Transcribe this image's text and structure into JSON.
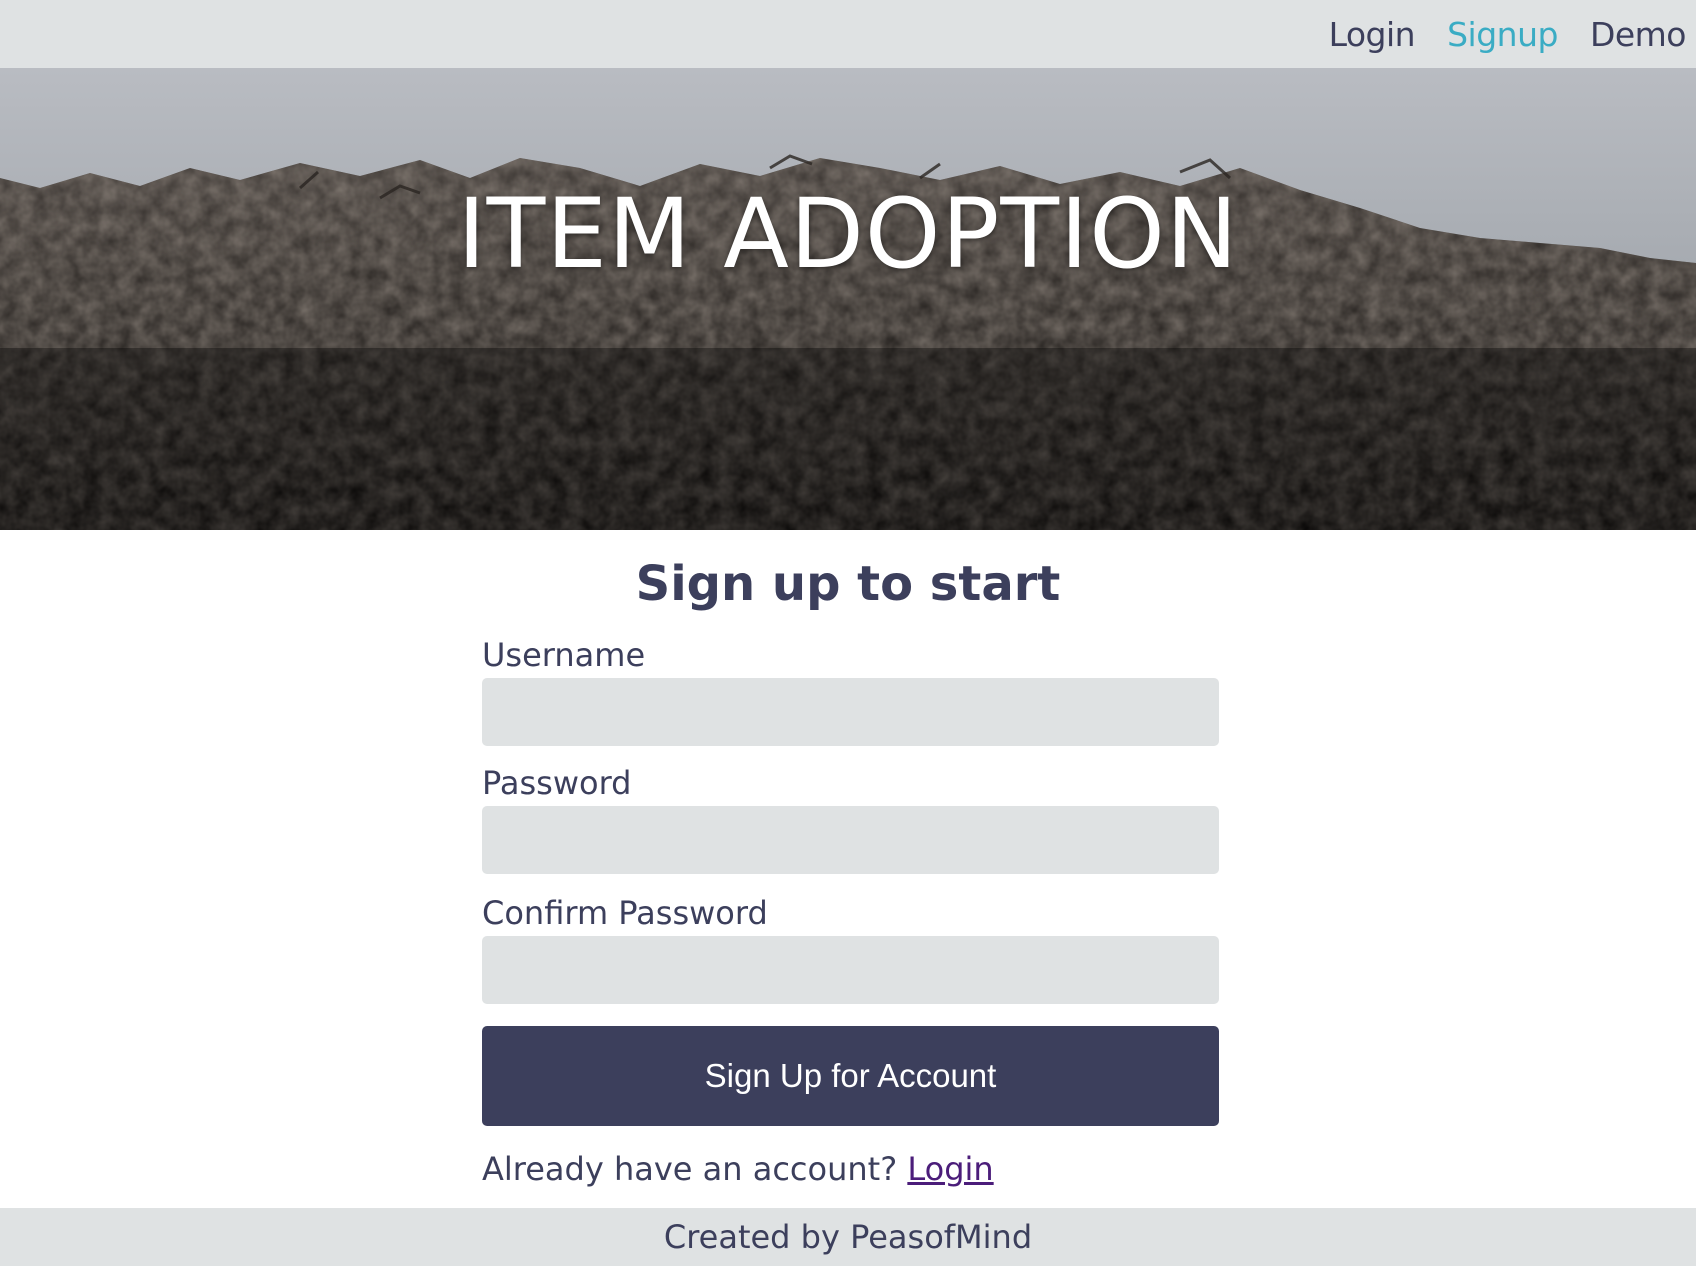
{
  "nav": {
    "items": [
      {
        "label": "Login",
        "active": false
      },
      {
        "label": "Signup",
        "active": true
      },
      {
        "label": "Demo",
        "active": false
      }
    ]
  },
  "hero": {
    "title": "ITEM ADOPTION"
  },
  "form": {
    "title": "Sign up to start",
    "username_label": "Username",
    "password_label": "Password",
    "confirm_label": "Confirm Password",
    "username_value": "",
    "password_value": "",
    "confirm_value": "",
    "submit_label": "Sign Up for Account",
    "already_text": "Already have an account?",
    "login_link": "Login"
  },
  "footer": {
    "text": "Created by PeasofMind"
  },
  "colors": {
    "accent": "#3aacc4",
    "primary": "#3c3f5c",
    "field_bg": "#dfe2e3",
    "link_visited": "#4b1d7a"
  }
}
